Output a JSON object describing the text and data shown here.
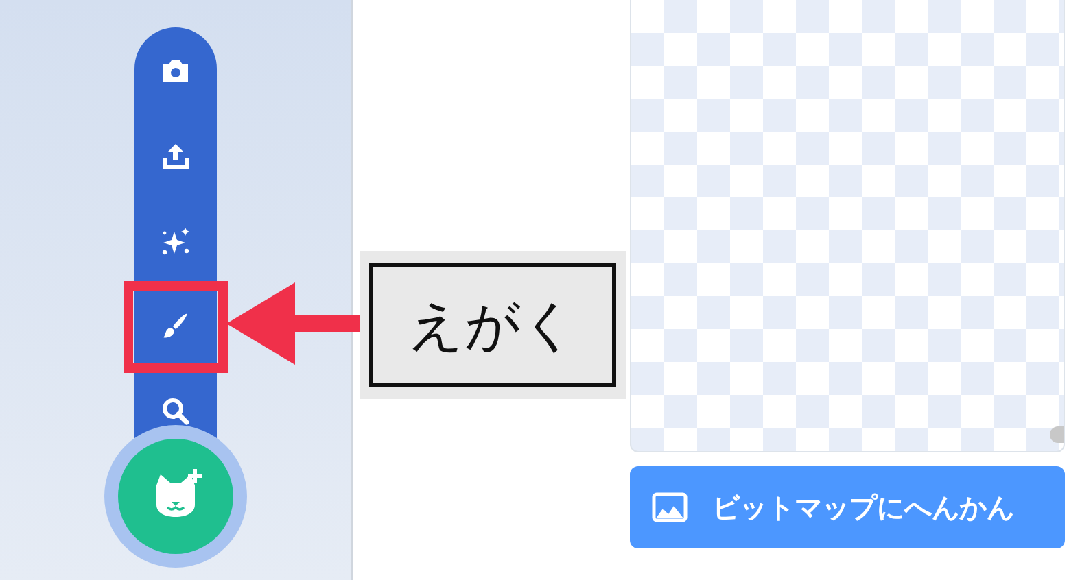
{
  "menu_items": [
    {
      "kind": "camera",
      "highlighted": false
    },
    {
      "kind": "upload",
      "highlighted": false
    },
    {
      "kind": "surprise",
      "highlighted": false
    },
    {
      "kind": "paint",
      "highlighted": true
    },
    {
      "kind": "search",
      "highlighted": false
    }
  ],
  "callout": {
    "label": "えがく"
  },
  "convert_button": {
    "label": "ビットマップにへんかん"
  }
}
